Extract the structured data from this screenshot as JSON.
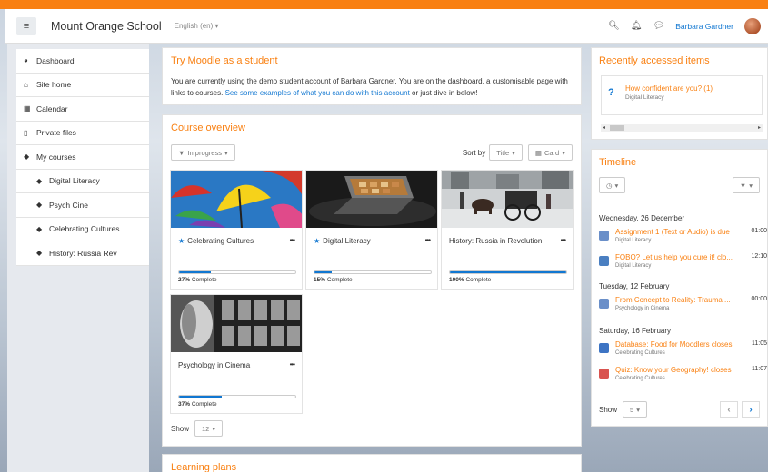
{
  "navbar": {
    "site_name": "Mount Orange School",
    "language": "English (en) ▾",
    "user_name": "Barbara Gardner"
  },
  "drawer": {
    "items": [
      {
        "label": "Dashboard",
        "icon": "dashboard-icon"
      },
      {
        "label": "Site home",
        "icon": "home-icon"
      },
      {
        "label": "Calendar",
        "icon": "calendar-icon"
      },
      {
        "label": "Private files",
        "icon": "file-icon"
      },
      {
        "label": "My courses",
        "icon": "graduation-cap-icon"
      },
      {
        "label": "Digital Literacy",
        "icon": "graduation-cap-icon"
      },
      {
        "label": "Psych Cine",
        "icon": "graduation-cap-icon"
      },
      {
        "label": "Celebrating Cultures",
        "icon": "graduation-cap-icon"
      },
      {
        "label": "History: Russia Rev",
        "icon": "graduation-cap-icon"
      }
    ]
  },
  "try_moodle": {
    "title": "Try Moodle as a student",
    "text_before": "You are currently using the demo student account of Barbara Gardner. You are on the dashboard, a customisable page with links to courses. ",
    "link": "See some examples of what you can do with this account",
    "text_after": " or just dive in below!"
  },
  "course_overview": {
    "title": "Course overview",
    "filter": "In progress",
    "sort_label": "Sort by",
    "sort_value": "Title",
    "view_value": "Card",
    "courses": [
      {
        "name": "Celebrating Cultures",
        "starred": true,
        "progress": 27,
        "complete_label": "Complete"
      },
      {
        "name": "Digital Literacy",
        "starred": true,
        "progress": 15,
        "complete_label": "Complete"
      },
      {
        "name": "History: Russia in Revolution",
        "starred": false,
        "progress": 100,
        "complete_label": "Complete"
      },
      {
        "name": "Psychology in Cinema",
        "starred": false,
        "progress": 37,
        "complete_label": "Complete"
      }
    ],
    "show_label": "Show",
    "show_value": "12"
  },
  "learning_plans": {
    "title": "Learning plans"
  },
  "recent": {
    "title": "Recently accessed items",
    "item_name": "How confident are you? (1)",
    "item_course": "Digital Literacy"
  },
  "timeline": {
    "title": "Timeline",
    "groups": [
      {
        "date": "Wednesday, 26 December",
        "events": [
          {
            "name": "Assignment 1 (Text or Audio) is due",
            "course": "Digital Literacy",
            "time": "01:00",
            "icon": "assignment-icon"
          },
          {
            "name": "FOBO? Let us help you cure it! clo...",
            "course": "Digital Literacy",
            "time": "12:10",
            "icon": "choice-icon"
          }
        ]
      },
      {
        "date": "Tuesday, 12 February",
        "events": [
          {
            "name": "From Concept to Reality: Trauma ...",
            "course": "Psychology in Cinema",
            "time": "00:00",
            "icon": "assignment-icon"
          }
        ]
      },
      {
        "date": "Saturday, 16 February",
        "events": [
          {
            "name": "Database: Food for Moodlers closes",
            "course": "Celebrating Cultures",
            "time": "11:05",
            "icon": "database-icon"
          },
          {
            "name": "Quiz: Know your Geography! closes",
            "course": "Celebrating Cultures",
            "time": "11:07",
            "icon": "quiz-icon"
          }
        ]
      }
    ],
    "show_label": "Show",
    "show_value": "5"
  }
}
